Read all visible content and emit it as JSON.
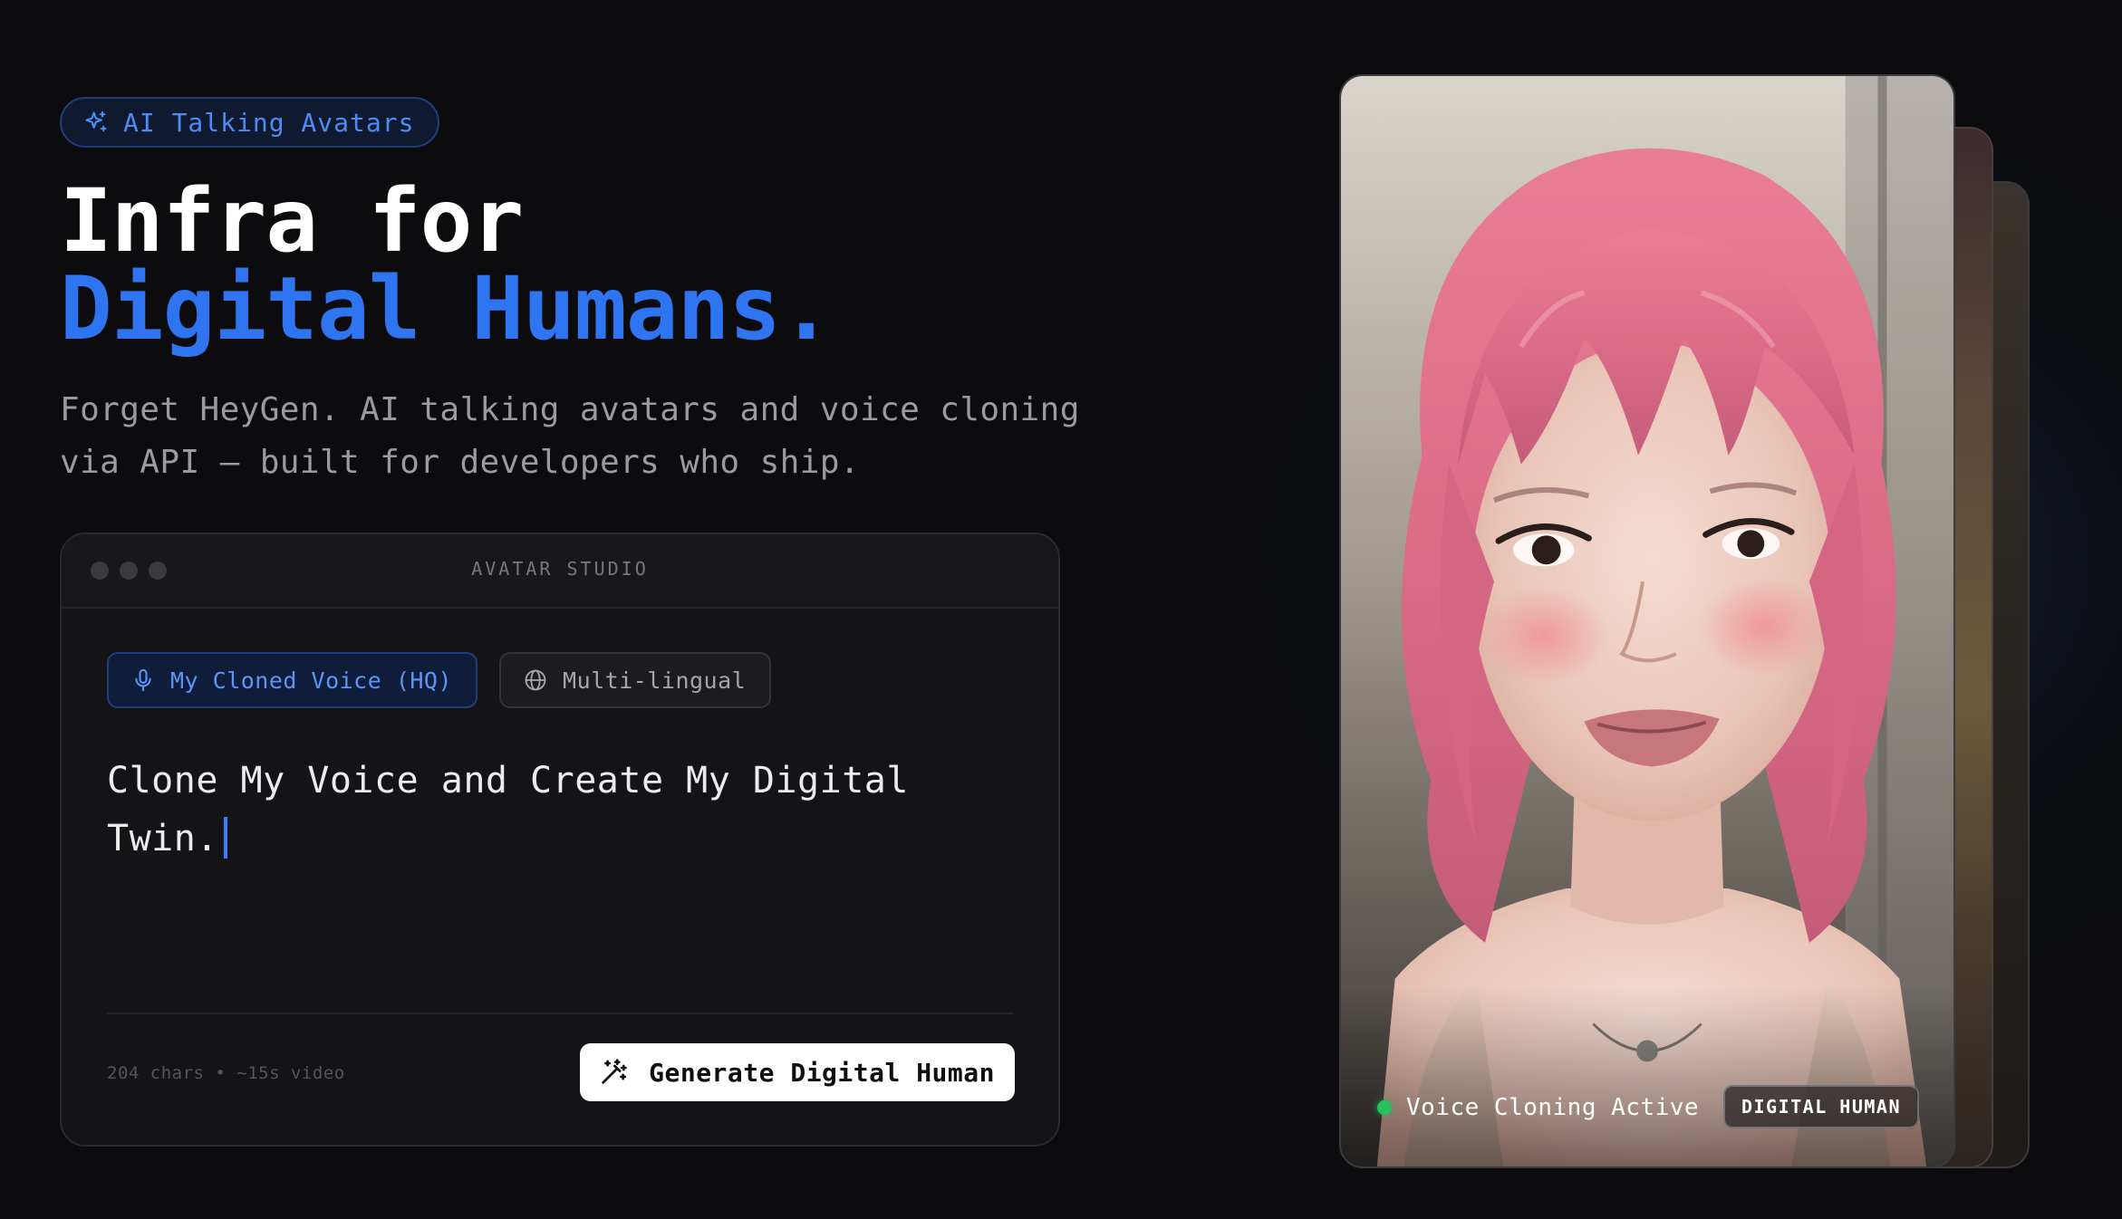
{
  "hero": {
    "badge_label": "AI Talking Avatars",
    "title_line1": "Infra for",
    "title_line2": "Digital Humans.",
    "subtitle": "Forget HeyGen. AI talking avatars and voice cloning via API — built for developers who ship."
  },
  "studio": {
    "title": "AVATAR STUDIO",
    "voice_chip_label": "My Cloned Voice (HQ)",
    "language_chip_label": "Multi-lingual",
    "prompt_text": "Clone My Voice and Create My Digital Twin.",
    "meta": "204 chars • ~15s video",
    "generate_label": "Generate Digital Human"
  },
  "avatar": {
    "status_label": "Voice Cloning Active",
    "tag_label": "DIGITAL HUMAN"
  },
  "icons": {
    "badge": "sparkles-icon",
    "voice_chip": "microphone-icon",
    "language_chip": "globe-icon",
    "generate": "magic-wand-icon"
  },
  "colors": {
    "accent": "#2f74f0",
    "background": "#0c0c0e",
    "status_active": "#27c25e"
  }
}
